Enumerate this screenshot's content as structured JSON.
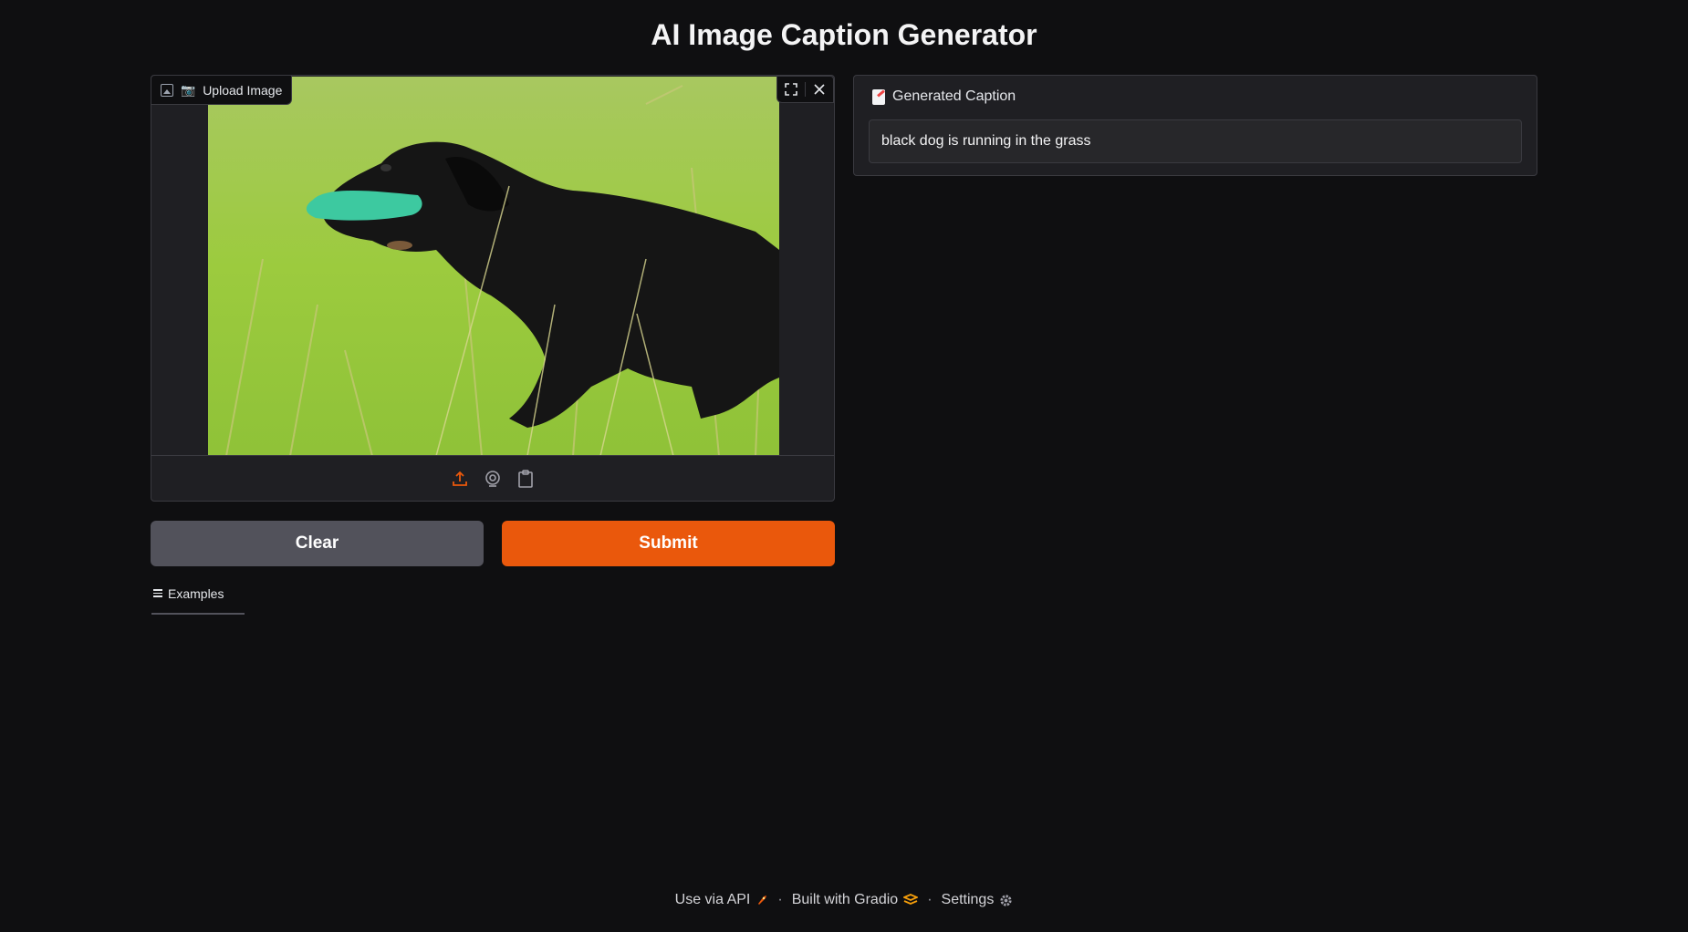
{
  "page": {
    "title": "AI Image Caption Generator"
  },
  "input_image": {
    "label": "Upload Image",
    "label_emoji": "📷",
    "image_description": "photo"
  },
  "buttons": {
    "clear": "Clear",
    "submit": "Submit"
  },
  "examples": {
    "label": "Examples"
  },
  "output": {
    "label": "Generated Caption",
    "value": "black dog is running in the grass"
  },
  "footer": {
    "api": "Use via API",
    "built_with": "Built with Gradio",
    "settings": "Settings",
    "separator": "·"
  },
  "colors": {
    "background": "#0f0f11",
    "panel": "#1f1f23",
    "accent": "#ea580c",
    "secondary_button": "#52525b"
  },
  "icons": [
    "image-icon",
    "camera-emoji-icon",
    "fullscreen-icon",
    "close-icon",
    "upload-icon",
    "webcam-icon",
    "clipboard-icon",
    "list-icon",
    "memo-icon",
    "rocket-icon",
    "gradio-logo-icon",
    "gear-icon"
  ]
}
